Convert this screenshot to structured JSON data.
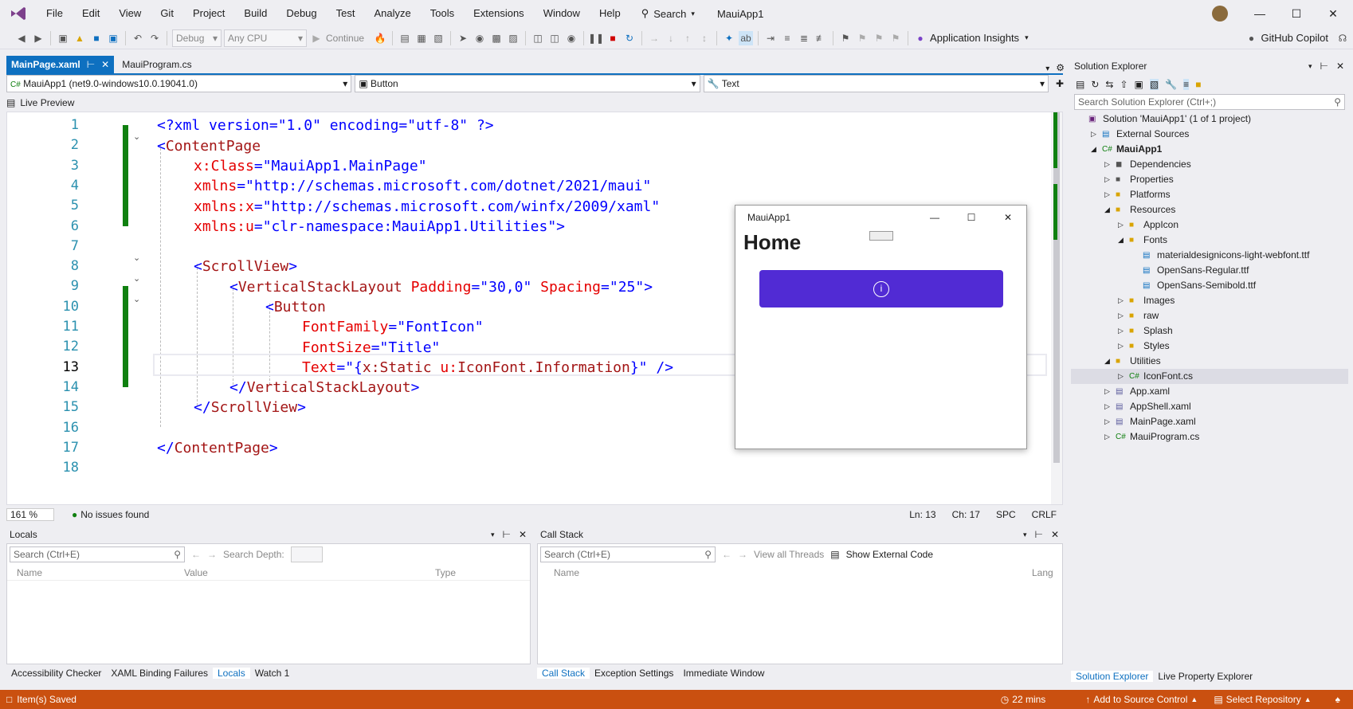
{
  "menubar": {
    "items": [
      "File",
      "Edit",
      "View",
      "Git",
      "Project",
      "Build",
      "Debug",
      "Test",
      "Analyze",
      "Tools",
      "Extensions",
      "Window",
      "Help"
    ],
    "search_label": "Search",
    "solution_name": "MauiApp1"
  },
  "toolbar": {
    "config": "Debug",
    "platform": "Any CPU",
    "continue_label": "Continue",
    "insights_label": "Application Insights",
    "copilot_label": "GitHub Copilot"
  },
  "doc_tabs": [
    {
      "label": "MainPage.xaml"
    },
    {
      "label": "MauiProgram.cs"
    }
  ],
  "navbar": {
    "project": "MauiApp1 (net9.0-windows10.0.19041.0)",
    "element": "Button",
    "property": "Text"
  },
  "live_preview": "Live Preview",
  "code": {
    "line_numbers": [
      "1",
      "2",
      "3",
      "4",
      "5",
      "6",
      "7",
      "8",
      "9",
      "10",
      "11",
      "12",
      "13",
      "14",
      "15",
      "16",
      "17",
      "18"
    ],
    "l1a": "<?xml version=\"1.0\" encoding=\"utf-8\" ?>",
    "l2a": "<",
    "l2b": "ContentPage",
    "l3a": "x:Class",
    "l3b": "=\"MauiApp1.MainPage\"",
    "l4a": "xmlns",
    "l4b": "=\"http://schemas.microsoft.com/dotnet/2021/maui\"",
    "l5a": "xmlns:x",
    "l5b": "=\"http://schemas.microsoft.com/winfx/2009/xaml\"",
    "l6a": "xmlns:u",
    "l6b": "=\"clr-namespace:MauiApp1.Utilities\">",
    "l8a": "<",
    "l8b": "ScrollView",
    "l8c": ">",
    "l9a": "<",
    "l9b": "VerticalStackLayout",
    "l9c": " Padding",
    "l9d": "=\"30,0\"",
    "l9e": " Spacing",
    "l9f": "=\"25\">",
    "l10a": "<",
    "l10b": "Button",
    "l11a": "FontFamily",
    "l11b": "=\"FontIcon\"",
    "l12a": "FontSize",
    "l12b": "=\"Title\"",
    "l13a": "Text",
    "l13b": "=\"{",
    "l13c": "x:Static",
    "l13d": " u:",
    "l13e": "IconFont.Information",
    "l13f": "}\" />",
    "l14a": "</",
    "l14b": "VerticalStackLayout",
    "l14c": ">",
    "l15a": "</",
    "l15b": "ScrollView",
    "l15c": ">",
    "l17a": "</",
    "l17b": "ContentPage",
    "l17c": ">"
  },
  "editor_status": {
    "zoom": "161 %",
    "issues": "No issues found",
    "ln": "Ln: 13",
    "ch": "Ch: 17",
    "spc": "SPC",
    "crlf": "CRLF"
  },
  "locals": {
    "title": "Locals",
    "search_placeholder": "Search (Ctrl+E)",
    "search_depth": "Search Depth:",
    "columns": [
      "Name",
      "Value",
      "Type"
    ],
    "tabs": [
      "Accessibility Checker",
      "XAML Binding Failures",
      "Locals",
      "Watch 1"
    ]
  },
  "callstack": {
    "title": "Call Stack",
    "search_placeholder": "Search (Ctrl+E)",
    "view_threads": "View all Threads",
    "show_external": "Show External Code",
    "columns": [
      "Name",
      "Lang"
    ],
    "tabs": [
      "Call Stack",
      "Exception Settings",
      "Immediate Window"
    ]
  },
  "solution_explorer": {
    "title": "Solution Explorer",
    "search_placeholder": "Search Solution Explorer (Ctrl+;)",
    "items": [
      "Solution 'MauiApp1' (1 of 1 project)",
      "External Sources",
      "MauiApp1",
      "Dependencies",
      "Properties",
      "Platforms",
      "Resources",
      "AppIcon",
      "Fonts",
      "materialdesignicons-light-webfont.ttf",
      "OpenSans-Regular.ttf",
      "OpenSans-Semibold.ttf",
      "Images",
      "raw",
      "Splash",
      "Styles",
      "Utilities",
      "IconFont.cs",
      "App.xaml",
      "AppShell.xaml",
      "MainPage.xaml",
      "MauiProgram.cs"
    ],
    "tabs": [
      "Solution Explorer",
      "Live Property Explorer"
    ]
  },
  "maui_window": {
    "title": "MauiApp1",
    "heading": "Home",
    "button_color": "#512bd4"
  },
  "statusbar": {
    "saved": "Item(s) Saved",
    "time": "22 mins",
    "source_control": "Add to Source Control",
    "repo": "Select Repository"
  },
  "colors": {
    "accent": "#0e70c0",
    "statusbar": "#ca5010",
    "change_bar": "#108010"
  }
}
